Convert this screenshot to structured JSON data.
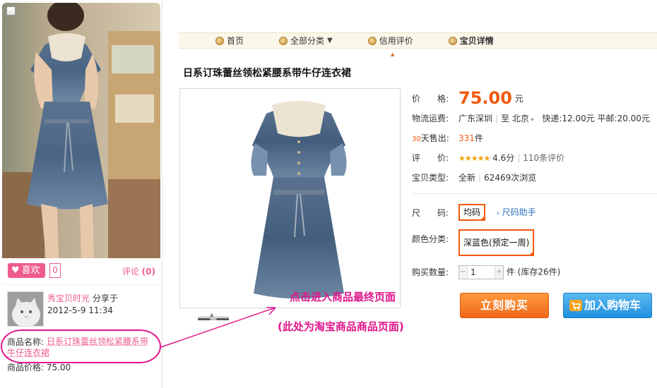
{
  "left_card": {
    "like_label": "喜欢",
    "like_count": "0",
    "comment_label": "评论",
    "comment_count": "(0)",
    "sharer": {
      "name": "秀宝贝时光",
      "action": "分享于",
      "time": "2012-5-9 11:34"
    },
    "product_name_label": "商品名称:",
    "product_name": "日系订珠蕾丝领松紧腰系带牛仔连衣裙",
    "product_price_label": "商品价格:",
    "product_price": "75.00"
  },
  "nav": {
    "items": [
      {
        "label": "首页",
        "icon": "home-icon"
      },
      {
        "label": "全部分类",
        "icon": "category-icon",
        "dropdown": "▼"
      },
      {
        "label": "信用评价",
        "icon": "rating-icon"
      },
      {
        "label": "宝贝详情",
        "icon": "detail-icon"
      }
    ]
  },
  "product": {
    "title": "日系订珠蕾丝领松紧腰系带牛仔连衣裙",
    "price_label": "价　　格:",
    "price": "75.00",
    "price_unit": "元",
    "shipping_label": "物流运费:",
    "ship_from": "广东深圳",
    "ship_to_prefix": "至",
    "ship_to": "北京",
    "express": "快递:12.00元",
    "surface_mail": "平邮:20.00元",
    "sold_days": "30",
    "sold_label": "天售出:",
    "sold_count": "331",
    "sold_unit": "件",
    "rating_label": "评　　价:",
    "rating_stars": "★★★★★",
    "rating_score": "4.6分",
    "review_count": "110条评价",
    "type_label": "宝贝类型:",
    "type_value": "全新",
    "views": "62469次浏览",
    "size_label": "尺　　码:",
    "size_value": "均码",
    "size_helper": "尺码助手",
    "color_label": "颜色分类:",
    "color_value": "深蓝色(预定一周)",
    "qty_label": "购买数量:",
    "qty_value": "1",
    "stock_text": "件 (库存26件)",
    "buy_now": "立刻购买",
    "add_cart": "加入购物车"
  },
  "annotations": {
    "line1": "点击进入商品最终页面",
    "line2": "(此处为淘宝商品商品页面)"
  },
  "colors": {
    "accent_pink": "#e0168b",
    "price_orange": "#f25a0f",
    "cart_blue": "#1f90df"
  }
}
